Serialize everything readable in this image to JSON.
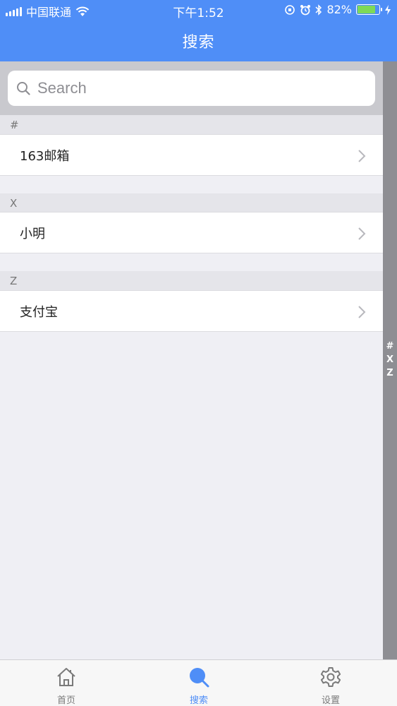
{
  "status_bar": {
    "carrier": "中国联通",
    "time": "下午1:52",
    "battery_text": "82%",
    "battery_level": 0.82
  },
  "nav": {
    "title": "搜索"
  },
  "search": {
    "placeholder": "Search"
  },
  "sections": [
    {
      "header": "#",
      "items": [
        "163邮箱"
      ]
    },
    {
      "header": "X",
      "items": [
        "小明"
      ]
    },
    {
      "header": "Z",
      "items": [
        "支付宝"
      ]
    }
  ],
  "index_bar": [
    "#",
    "X",
    "Z"
  ],
  "tabs": [
    {
      "label": "首页",
      "icon": "home-icon",
      "active": false
    },
    {
      "label": "搜索",
      "icon": "search-icon",
      "active": true
    },
    {
      "label": "设置",
      "icon": "gear-icon",
      "active": false
    }
  ],
  "colors": {
    "nav_bg": "#4f8ef7",
    "active_tab": "#4f8ef7",
    "index_bar_bg": "#8e8e93"
  }
}
